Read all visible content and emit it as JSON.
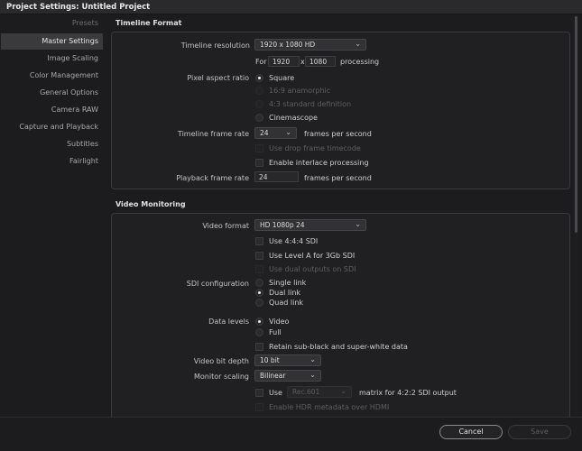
{
  "window": {
    "title": "Project Settings:  Untitled Project"
  },
  "sidebar": {
    "items": [
      {
        "label": "Presets"
      },
      {
        "label": "Master Settings"
      },
      {
        "label": "Image Scaling"
      },
      {
        "label": "Color Management"
      },
      {
        "label": "General Options"
      },
      {
        "label": "Camera RAW"
      },
      {
        "label": "Capture and Playback"
      },
      {
        "label": "Subtitles"
      },
      {
        "label": "Fairlight"
      }
    ]
  },
  "timeline_format": {
    "title": "Timeline Format",
    "resolution_label": "Timeline resolution",
    "resolution_value": "1920 x 1080 HD",
    "for_label": "For",
    "width": "1920",
    "x_label": "x",
    "height": "1080",
    "processing_label": "processing",
    "par_label": "Pixel aspect ratio",
    "par_options": [
      "Square",
      "16:9 anamorphic",
      "4:3 standard definition",
      "Cinemascope"
    ],
    "frame_rate_label": "Timeline frame rate",
    "frame_rate_value": "24",
    "fps_label": "frames per second",
    "drop_frame_label": "Use drop frame timecode",
    "interlace_label": "Enable interlace processing",
    "playback_label": "Playback frame rate",
    "playback_value": "24",
    "playback_fps_label": "frames per second"
  },
  "video_monitoring": {
    "title": "Video Monitoring",
    "format_label": "Video format",
    "format_value": "HD 1080p 24",
    "use444_label": "Use 4:4:4 SDI",
    "levelA_label": "Use Level A for 3Gb SDI",
    "dual_outputs_label": "Use dual outputs on SDI",
    "sdi_label": "SDI configuration",
    "sdi_options": [
      "Single link",
      "Dual link",
      "Quad link"
    ],
    "data_levels_label": "Data levels",
    "data_levels_options": [
      "Video",
      "Full"
    ],
    "retain_label": "Retain sub-black and super-white data",
    "bit_depth_label": "Video bit depth",
    "bit_depth_value": "10 bit",
    "monitor_scaling_label": "Monitor scaling",
    "monitor_scaling_value": "Bilinear",
    "use_label": "Use",
    "matrix_value": "Rec.601",
    "matrix_label": "matrix for 4:2:2 SDI output",
    "hdr_label": "Enable HDR metadata over HDMI"
  },
  "footer": {
    "cancel_label": "Cancel",
    "save_label": "Save"
  }
}
